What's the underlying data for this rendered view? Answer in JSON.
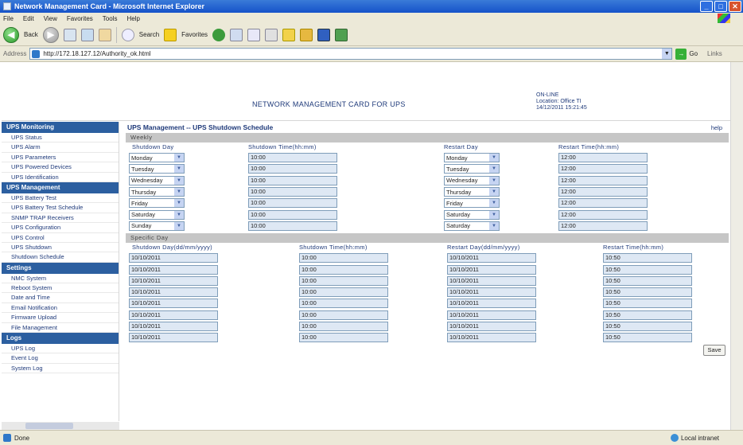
{
  "window": {
    "title": "Network Management Card - Microsoft Internet Explorer"
  },
  "menu": [
    "File",
    "Edit",
    "View",
    "Favorites",
    "Tools",
    "Help"
  ],
  "toolbar": {
    "back_label": "Back",
    "search_label": "Search",
    "favorites_label": "Favorites"
  },
  "address": {
    "label": "Address",
    "url": "http://172.18.127.12/Authority_ok.html",
    "go_label": "Go",
    "links_label": "Links"
  },
  "header": {
    "title": "NETWORK MANAGEMENT CARD FOR UPS",
    "info_1": "ON-LINE",
    "info_2": "Location: Office TI",
    "info_3": "14/12/2011 15:21:45"
  },
  "sidebar": [
    {
      "head": "UPS Monitoring",
      "items": [
        "UPS Status",
        "UPS Alarm",
        "UPS Parameters",
        "UPS Powered Devices",
        "UPS Identification"
      ]
    },
    {
      "head": "UPS Management",
      "items": [
        "UPS Battery Test",
        "UPS Battery Test Schedule",
        "SNMP TRAP Receivers",
        "UPS Configuration",
        "UPS Control",
        "UPS Shutdown",
        "Shutdown Schedule"
      ]
    },
    {
      "head": "Settings",
      "items": [
        "NMC System",
        "Reboot System",
        "Date and Time",
        "Email Notification",
        "Firmware Upload",
        "File Management"
      ]
    },
    {
      "head": "Logs",
      "items": [
        "UPS Log",
        "Event Log",
        "System Log"
      ]
    }
  ],
  "main": {
    "title": "UPS Management -- UPS Shutdown Schedule",
    "help": "help",
    "weekly": {
      "section": "Weekly",
      "headers": [
        "Shutdown Day",
        "Shutdown Time(hh:mm)",
        "Restart Day",
        "Restart Time(hh:mm)"
      ],
      "rows": [
        [
          "Monday",
          "10:00",
          "Monday",
          "12:00"
        ],
        [
          "Tuesday",
          "10:00",
          "Tuesday",
          "12:00"
        ],
        [
          "Wednesday",
          "10:00",
          "Wednesday",
          "12:00"
        ],
        [
          "Thursday",
          "10:00",
          "Thursday",
          "12:00"
        ],
        [
          "Friday",
          "10:00",
          "Friday",
          "12:00"
        ],
        [
          "Saturday",
          "10:00",
          "Saturday",
          "12:00"
        ],
        [
          "Sunday",
          "10:00",
          "Saturday",
          "12:00"
        ]
      ]
    },
    "specific": {
      "section": "Specific Day",
      "headers": [
        "Shutdown Day(dd/mm/yyyy)",
        "Shutdown Time(hh:mm)",
        "Restart Day(dd/mm/yyyy)",
        "Restart Time(hh:mm)"
      ],
      "rows": [
        [
          "10/10/2011",
          "10:00",
          "10/10/2011",
          "10:50"
        ],
        [
          "10/10/2011",
          "10:00",
          "10/10/2011",
          "10:50"
        ],
        [
          "10/10/2011",
          "10:00",
          "10/10/2011",
          "10:50"
        ],
        [
          "10/10/2011",
          "10:00",
          "10/10/2011",
          "10:50"
        ],
        [
          "10/10/2011",
          "10:00",
          "10/10/2011",
          "10:50"
        ],
        [
          "10/10/2011",
          "10:00",
          "10/10/2011",
          "10:50"
        ],
        [
          "10/10/2011",
          "10:00",
          "10/10/2011",
          "10:50"
        ],
        [
          "10/10/2011",
          "10:00",
          "10/10/2011",
          "10:50"
        ]
      ]
    },
    "save_label": "Save"
  },
  "status": {
    "text": "Done",
    "zone": "Local intranet"
  },
  "colors": {
    "sidebar_head": "#2c5fa0",
    "section_head": "#c6c6c6",
    "link": "#1f3a7a"
  }
}
